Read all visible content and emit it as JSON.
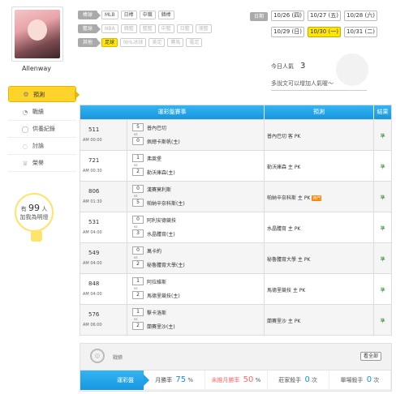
{
  "user": {
    "name": "Allenway"
  },
  "nav": [
    {
      "label": "預測",
      "icon": "gear-icon"
    },
    {
      "label": "戰績",
      "icon": "chat-icon"
    },
    {
      "label": "供養紀錄",
      "icon": "ring-icon"
    },
    {
      "label": "討論",
      "icon": "bubble-icon"
    },
    {
      "label": "榮譽",
      "icon": "trophy-icon"
    }
  ],
  "bulb": {
    "prefix": "有",
    "count": "99",
    "suffix": "人",
    "caption": "加我為明燈"
  },
  "filters": {
    "row1": {
      "label": "棒球",
      "chips": [
        "MLB",
        "日棒",
        "中職",
        "韓棒"
      ]
    },
    "row2": {
      "label": "籃球",
      "chips": [
        "NBA",
        "韓籃",
        "籃籃",
        "中籃",
        "日籃",
        "澳籃"
      ]
    },
    "row3": {
      "label": "其他",
      "chips": [
        "足球",
        "NHL冰球",
        "美足",
        "賽馬",
        "電足"
      ]
    }
  },
  "dates": {
    "label": "日期",
    "items": [
      "10/26 (四)",
      "10/27 (五)",
      "10/28 (六)",
      "10/29 (日)",
      "10/30 (一)",
      "10/31 (二)"
    ],
    "selected": "10/30 (一)"
  },
  "views": {
    "label": "今日人氣",
    "count": "3"
  },
  "note": "多說文可以增加人氣喔～",
  "table": {
    "headers": [
      "運彩盤賽事",
      "預測",
      "結果"
    ],
    "rows": [
      {
        "num": "511",
        "time": "AM 00:00",
        "s1": "5",
        "s2": "0",
        "t1": "普內巴切",
        "t2": "佩總卡斯帆(主)",
        "pred": "普內巴切 客 PK",
        "hot": "",
        "result": "準"
      },
      {
        "num": "721",
        "time": "AM 00:30",
        "s1": "1",
        "s2": "2",
        "t1": "弗萊堡",
        "t2": "勒沃庫森(主)",
        "pred": "勒沃庫森 主 PK",
        "hot": "",
        "result": "準"
      },
      {
        "num": "806",
        "time": "AM 01:30",
        "s1": "0",
        "s2": "5",
        "t1": "漢賽莫利斯",
        "t2": "帕納辛奈科斯(主)",
        "pred": "帕納辛奈科斯 主 PK",
        "hot": "熱門",
        "result": "準"
      },
      {
        "num": "531",
        "time": "AM 04:00",
        "s1": "0",
        "s2": "3",
        "t1": "阿利安德競技",
        "t2": "水晶體育(主)",
        "pred": "水晶體育 主 PK",
        "hot": "",
        "result": "準"
      },
      {
        "num": "549",
        "time": "AM 04:00",
        "s1": "0",
        "s2": "2",
        "t1": "萬卡約",
        "t2": "秘魯體育大學(主)",
        "pred": "秘魯體育大學 主 PK",
        "hot": "",
        "result": "準"
      },
      {
        "num": "848",
        "time": "AM 04:00",
        "s1": "1",
        "s2": "2",
        "t1": "阿拉維斯",
        "t2": "馬德里競技(主)",
        "pred": "馬德里競技 主 PK",
        "hot": "",
        "result": "準"
      },
      {
        "num": "576",
        "time": "AM 06:00",
        "s1": "1",
        "s2": "2",
        "t1": "擊卡洛斯",
        "t2": "蘭賽里沙(主)",
        "pred": "蘭賽里沙 主 PK",
        "hot": "",
        "result": "準"
      }
    ]
  },
  "record": {
    "title": "戰績",
    "button": "看全部",
    "tab": "運彩盤",
    "stats": [
      {
        "label": "月勝率",
        "value": "75",
        "unit": "%"
      },
      {
        "label": "未推月勝率",
        "value": "50",
        "unit": "%"
      },
      {
        "label": "莊家殺手",
        "value": "0",
        "unit": "次"
      },
      {
        "label": "單場殺手",
        "value": "0",
        "unit": "次"
      }
    ]
  },
  "colors": {
    "accent": "#1a9ae3",
    "highlight": "#ffe600",
    "result": "#2a8a2a"
  }
}
